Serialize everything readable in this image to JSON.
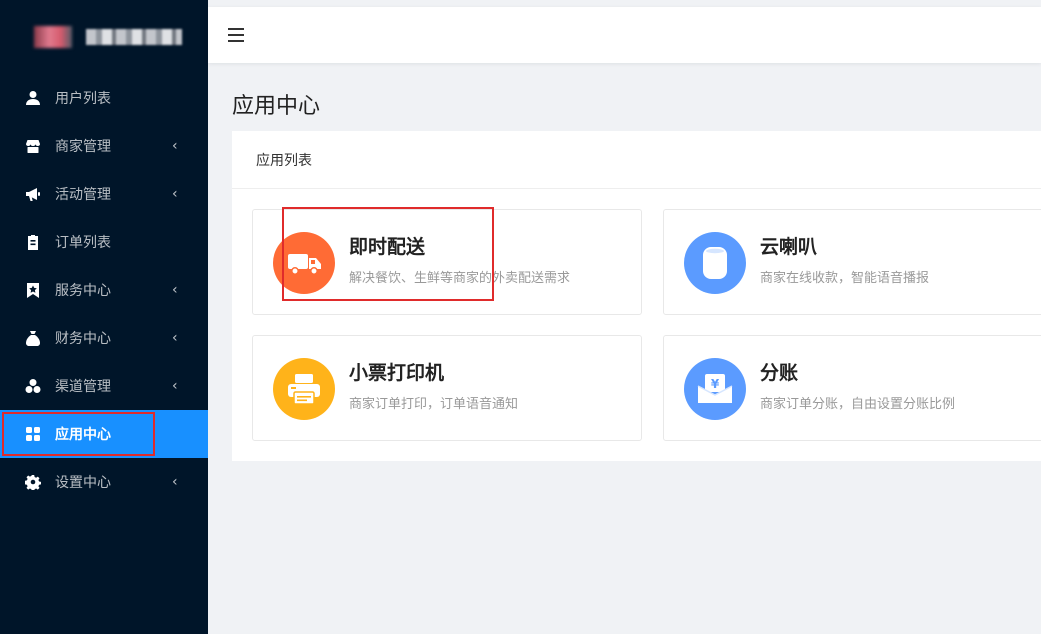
{
  "sidebar": {
    "items": [
      {
        "label": "用户列表",
        "icon": "user-icon",
        "has_arrow": false
      },
      {
        "label": "商家管理",
        "icon": "store-icon",
        "has_arrow": true
      },
      {
        "label": "活动管理",
        "icon": "megaphone-icon",
        "has_arrow": true
      },
      {
        "label": "订单列表",
        "icon": "clipboard-icon",
        "has_arrow": false
      },
      {
        "label": "服务中心",
        "icon": "bookmark-icon",
        "has_arrow": true
      },
      {
        "label": "财务中心",
        "icon": "moneybag-icon",
        "has_arrow": true
      },
      {
        "label": "渠道管理",
        "icon": "cluster-icon",
        "has_arrow": true
      },
      {
        "label": "应用中心",
        "icon": "apps-icon",
        "has_arrow": false,
        "active": true
      },
      {
        "label": "设置中心",
        "icon": "gear-icon",
        "has_arrow": true
      }
    ],
    "arrow_glyph": "‹",
    "active_color": "#1890ff",
    "background": "#001529"
  },
  "header": {
    "menu_icon": "hamburger-icon"
  },
  "page": {
    "title": "应用中心",
    "card_title": "应用列表"
  },
  "apps": [
    {
      "name": "即时配送",
      "desc": "解决餐饮、生鲜等商家的外卖配送需求",
      "icon": "truck-icon",
      "color": "#ff6b35"
    },
    {
      "name": "云喇叭",
      "desc": "商家在线收款，智能语音播报",
      "icon": "speaker-icon",
      "color": "#5b9bff"
    },
    {
      "name": "小票打印机",
      "desc": "商家订单打印，订单语音通知",
      "icon": "printer-icon",
      "color": "#ffb31a"
    },
    {
      "name": "分账",
      "desc": "商家订单分账，自由设置分账比例",
      "icon": "split-payment-icon",
      "color": "#5b9bff"
    }
  ],
  "highlight_color": "#e02b2b"
}
